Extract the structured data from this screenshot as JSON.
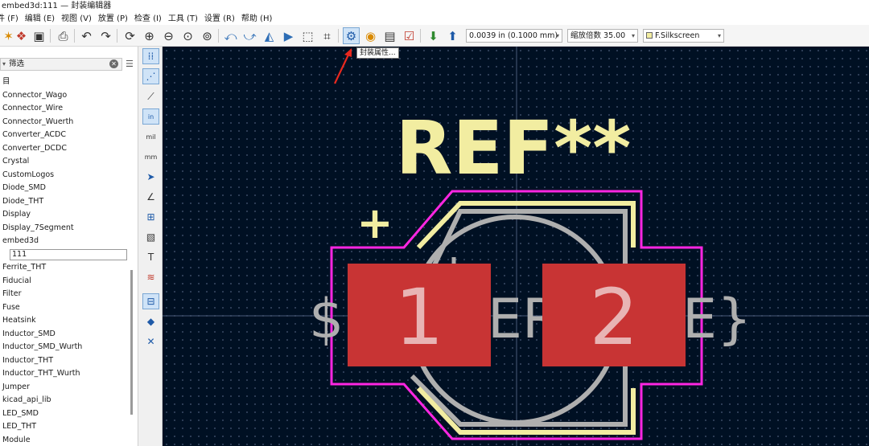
{
  "window": {
    "title": "embed3d:111 — 封装编辑器"
  },
  "menu": [
    "件 (F)",
    "编辑 (E)",
    "视图 (V)",
    "放置 (P)",
    "检查 (I)",
    "工具 (T)",
    "设置 (R)",
    "帮助 (H)"
  ],
  "toolbar": {
    "grid_value": "0.0039 in (0.1000 mm)",
    "zoom_value": "缩放倍数 35.00",
    "layer_value": "F.Silkscreen",
    "layer_color": "#f2eda1",
    "tooltip": "封装属性..."
  },
  "library_panel": {
    "filter_placeholder": "筛选",
    "items": [
      "目",
      "Connector_Wago",
      "Connector_Wire",
      "Connector_Wuerth",
      "Converter_ACDC",
      "Converter_DCDC",
      "Crystal",
      "CustomLogos",
      "Diode_SMD",
      "Diode_THT",
      "Display",
      "Display_7Segment",
      "embed3d"
    ],
    "selected_child": "111",
    "items_after": [
      "Ferrite_THT",
      "Fiducial",
      "Filter",
      "Fuse",
      "Heatsink",
      "Inductor_SMD",
      "Inductor_SMD_Wurth",
      "Inductor_THT",
      "Inductor_THT_Wurth",
      "Jumper",
      "kicad_api_lib",
      "LED_SMD",
      "LED_THT",
      "Module"
    ]
  },
  "canvas": {
    "reference": "REF**",
    "value_text_left": "$",
    "value_text_mid": "ER",
    "value_text_right": "E}",
    "plus_mark": "+",
    "pads": [
      {
        "number": "1"
      },
      {
        "number": "2"
      }
    ],
    "colors": {
      "background": "#001023",
      "silkscreen": "#f2eda1",
      "courtyard": "#ff26e2",
      "fab": "#afafaf",
      "pad": "#c83434"
    }
  }
}
